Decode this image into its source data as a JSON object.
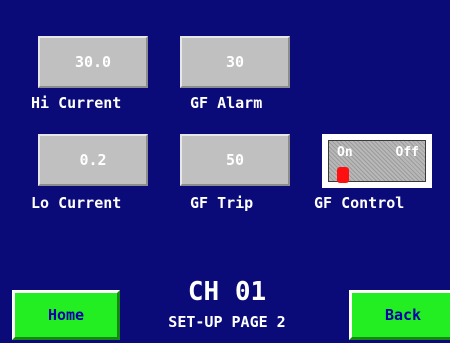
{
  "fields": {
    "hi_current": {
      "value": "30.0",
      "label": "Hi Current"
    },
    "gf_alarm": {
      "value": "30",
      "label": "GF Alarm"
    },
    "lo_current": {
      "value": "0.2",
      "label": "Lo Current"
    },
    "gf_trip": {
      "value": "50",
      "label": "GF Trip"
    }
  },
  "gf_control": {
    "label": "GF Control",
    "on_label": "On",
    "off_label": "Off",
    "state": "on"
  },
  "header": {
    "channel": "CH 01",
    "page": "SET-UP PAGE 2"
  },
  "nav": {
    "home_label": "Home",
    "back_label": "Back"
  },
  "colors": {
    "background": "#0a0a78",
    "readout": "#c0c0c0",
    "nav_button": "#22ee22",
    "nav_text": "#0000aa",
    "indicator_on": "#ff1010"
  }
}
